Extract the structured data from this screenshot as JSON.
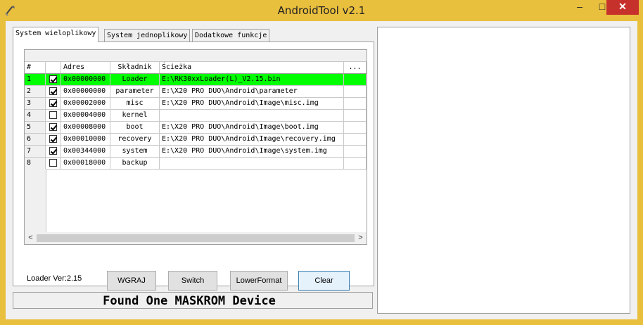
{
  "window": {
    "title": "AndroidTool v2.1",
    "minimize": "–",
    "maximize": "□",
    "close": "✕"
  },
  "tabs": [
    {
      "label": "System wieloplikowy",
      "active": true
    },
    {
      "label": "System jednoplikowy",
      "active": false
    },
    {
      "label": "Dodatkowe funkcje",
      "active": false
    }
  ],
  "table": {
    "columns": [
      "#",
      "",
      "Adres",
      "Składnik",
      "Ścieżka",
      "..."
    ],
    "rows": [
      {
        "num": "1",
        "checked": true,
        "addr": "0x00000000",
        "comp": "Loader",
        "path": "E:\\RK30xxLoader(L)_V2.15.bin",
        "highlight": true
      },
      {
        "num": "2",
        "checked": true,
        "addr": "0x00000000",
        "comp": "parameter",
        "path": "E:\\X20 PRO DUO\\Android\\parameter"
      },
      {
        "num": "3",
        "checked": true,
        "addr": "0x00002000",
        "comp": "misc",
        "path": "E:\\X20 PRO DUO\\Android\\Image\\misc.img"
      },
      {
        "num": "4",
        "checked": false,
        "addr": "0x00004000",
        "comp": "kernel",
        "path": ""
      },
      {
        "num": "5",
        "checked": true,
        "addr": "0x00008000",
        "comp": "boot",
        "path": "E:\\X20 PRO DUO\\Android\\Image\\boot.img"
      },
      {
        "num": "6",
        "checked": true,
        "addr": "0x00010000",
        "comp": "recovery",
        "path": "E:\\X20 PRO DUO\\Android\\Image\\recovery.img"
      },
      {
        "num": "7",
        "checked": true,
        "addr": "0x00344000",
        "comp": "system",
        "path": "E:\\X20 PRO DUO\\Android\\Image\\system.img"
      },
      {
        "num": "8",
        "checked": false,
        "addr": "0x00018000",
        "comp": "backup",
        "path": ""
      }
    ],
    "scroll_left": "<",
    "scroll_right": ">"
  },
  "loader_ver": "Loader Ver:2.15",
  "buttons": {
    "upload": "WGRAJ",
    "switch": "Switch",
    "lower_format": "LowerFormat",
    "clear": "Clear"
  },
  "status": "Found One MASKROM Device",
  "colors": {
    "titlebar": "#e9bf3e",
    "highlight_row": "#00ff00",
    "close_button": "#c7312b"
  }
}
